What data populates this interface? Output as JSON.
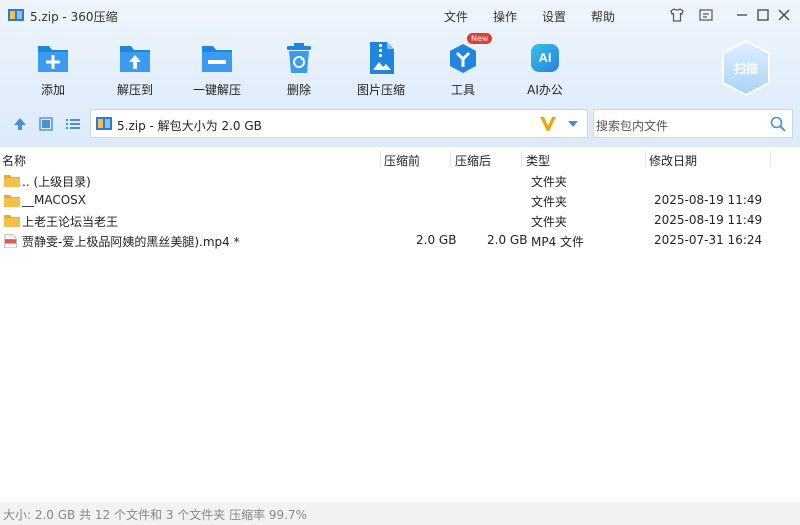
{
  "window": {
    "title": "5.zip - 360压缩"
  },
  "menu": [
    "文件",
    "操作",
    "设置",
    "帮助"
  ],
  "toolbar": {
    "add": "添加",
    "extract_to": "解压到",
    "one_click": "一键解压",
    "delete": "删除",
    "image_compress": "图片压缩",
    "tools": "工具",
    "tools_badge": "New",
    "ai": "AI办公",
    "ai_glyph": "AI",
    "scan": "扫描"
  },
  "path": {
    "text": "5.zip - 解包大小为 2.0 GB"
  },
  "search": {
    "placeholder": "搜索包内文件"
  },
  "columns": {
    "name": "名称",
    "packed": "压缩前",
    "compressed": "压缩后",
    "type": "类型",
    "modified": "修改日期"
  },
  "files": [
    {
      "icon": "folder",
      "name": ".. (上级目录)",
      "packed": "",
      "compressed": "",
      "type": "文件夹",
      "modified": ""
    },
    {
      "icon": "folder",
      "name": "__MACOSX",
      "packed": "",
      "compressed": "",
      "type": "文件夹",
      "modified": "2025-08-19 11:49"
    },
    {
      "icon": "folder",
      "name": "上老王论坛当老王",
      "packed": "",
      "compressed": "",
      "type": "文件夹",
      "modified": "2025-08-19 11:49"
    },
    {
      "icon": "mp4",
      "name": "贾静雯-爱上极品阿姨的黑丝美腿).mp4 *",
      "packed": "2.0 GB",
      "compressed": "2.0 GB",
      "type": "MP4 文件",
      "modified": "2025-07-31 16:24"
    }
  ],
  "status": {
    "text": "大小: 2.0 GB 共 12 个文件和 3 个文件夹 压缩率 99.7%"
  },
  "colors": {
    "accent": "#1f86e0",
    "badge": "#e53935",
    "ai": "#27b4d8",
    "folder": "#f5c04a"
  }
}
